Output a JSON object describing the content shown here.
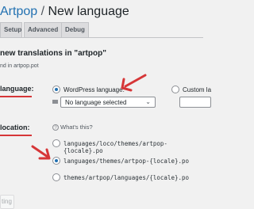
{
  "header": {
    "breadcrumb_link": "Artpop",
    "separator": " / ",
    "page_title": "New language"
  },
  "tabs": [
    {
      "label": "Setup"
    },
    {
      "label": "Advanced"
    },
    {
      "label": "Debug"
    }
  ],
  "section": {
    "heading": "new translations in \"artpop\"",
    "subtext": "nd in artpop.pot"
  },
  "language_row": {
    "label": "language:",
    "wordpress_option": "WordPress language:",
    "select_value": "No language selected",
    "custom_option": "Custom la"
  },
  "location_row": {
    "label": "location:",
    "help": "What's this?",
    "options": [
      "languages/loco/themes/artpop-{locale}.po",
      "languages/themes/artpop-{locale}.po",
      "themes/artpop/languages/{locale}.po"
    ]
  },
  "footer": {
    "button_label": "ting"
  },
  "colors": {
    "accent": "#2271b1",
    "annotation": "#d63638"
  }
}
